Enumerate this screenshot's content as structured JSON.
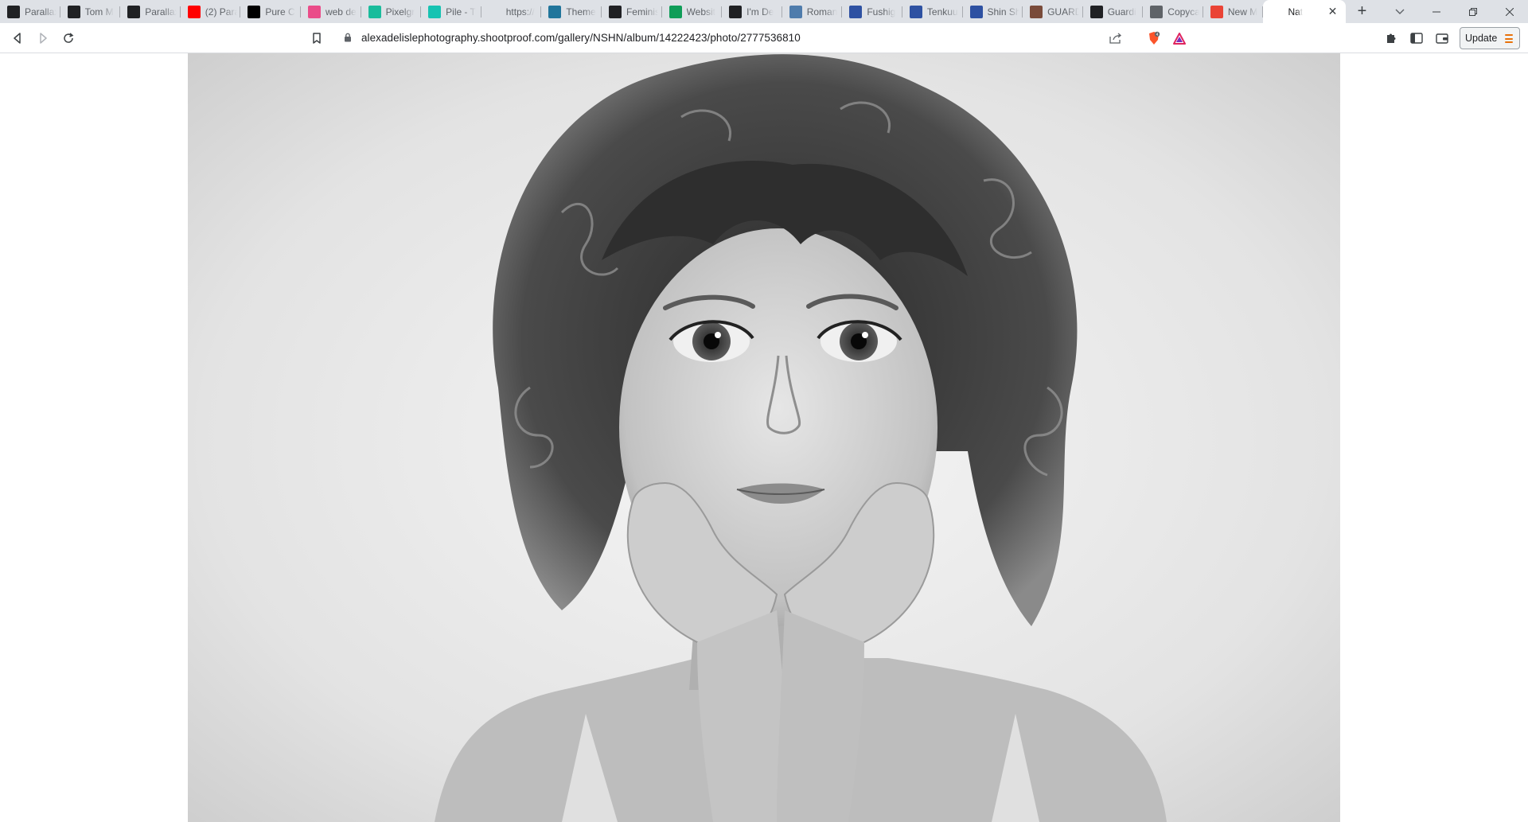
{
  "browser": {
    "tabs": [
      {
        "title": "Parallax",
        "icon": "layers-icon",
        "color": "#202124"
      },
      {
        "title": "Tom M",
        "icon": "codepen-icon",
        "color": "#202124"
      },
      {
        "title": "Parallax",
        "icon": "codepen-icon",
        "color": "#202124"
      },
      {
        "title": "(2) Para",
        "icon": "youtube-icon",
        "color": "#ff0000"
      },
      {
        "title": "Pure C",
        "icon": "medium-icon",
        "color": "#000000"
      },
      {
        "title": "web de",
        "icon": "dribbble-icon",
        "color": "#ea4c89"
      },
      {
        "title": "Pixelgr",
        "icon": "tag-icon",
        "color": "#1abc9c"
      },
      {
        "title": "Pile - T",
        "icon": "pen-icon",
        "color": "#17c3b2"
      },
      {
        "title": "https://",
        "icon": "blank-icon",
        "color": "#dee1e6"
      },
      {
        "title": "Theme",
        "icon": "wordpress-icon",
        "color": "#21759b"
      },
      {
        "title": "Feminis",
        "icon": "ampersand-icon",
        "color": "#202124"
      },
      {
        "title": "Websit",
        "icon": "plus-square-icon",
        "color": "#0f9d58"
      },
      {
        "title": "I'm De",
        "icon": "amazon-icon",
        "color": "#202124"
      },
      {
        "title": "Roman",
        "icon": "gear-icon",
        "color": "#4f7cac"
      },
      {
        "title": "Fushig",
        "icon": "mal-icon",
        "color": "#2e51a2"
      },
      {
        "title": "Tenkuu",
        "icon": "mal-icon",
        "color": "#2e51a2"
      },
      {
        "title": "Shin Sh",
        "icon": "mal-icon",
        "color": "#2e51a2"
      },
      {
        "title": "GUARD",
        "icon": "figure-icon",
        "color": "#7a4b3a"
      },
      {
        "title": "Guardi",
        "icon": "square-a-icon",
        "color": "#202124"
      },
      {
        "title": "Copyca",
        "icon": "card-icon",
        "color": "#5f6368"
      },
      {
        "title": "New M",
        "icon": "gmail-icon",
        "color": "#ea4335"
      },
      {
        "title": "Nat",
        "icon": "blank-icon",
        "color": "#ffffff",
        "active": true
      }
    ],
    "close_glyph": "✕",
    "new_tab_glyph": "+",
    "tab_search_glyph": "⌄",
    "window": {
      "minimize": "—",
      "restore": "❐",
      "close": "✕"
    },
    "url": "alexadelislephotography.shootproof.com/gallery/NSHN/album/14222423/photo/2777536810",
    "update_label": "Update"
  },
  "page": {
    "photo_subject": "child-portrait",
    "photo_tone": "black-and-white"
  },
  "colors": {
    "tabstrip_bg": "#dee1e6",
    "toolbar_bg": "#ffffff",
    "update_accent": "#e8710a",
    "brave_shield": "#fb542b",
    "brave_rewards": "#e0245e"
  }
}
